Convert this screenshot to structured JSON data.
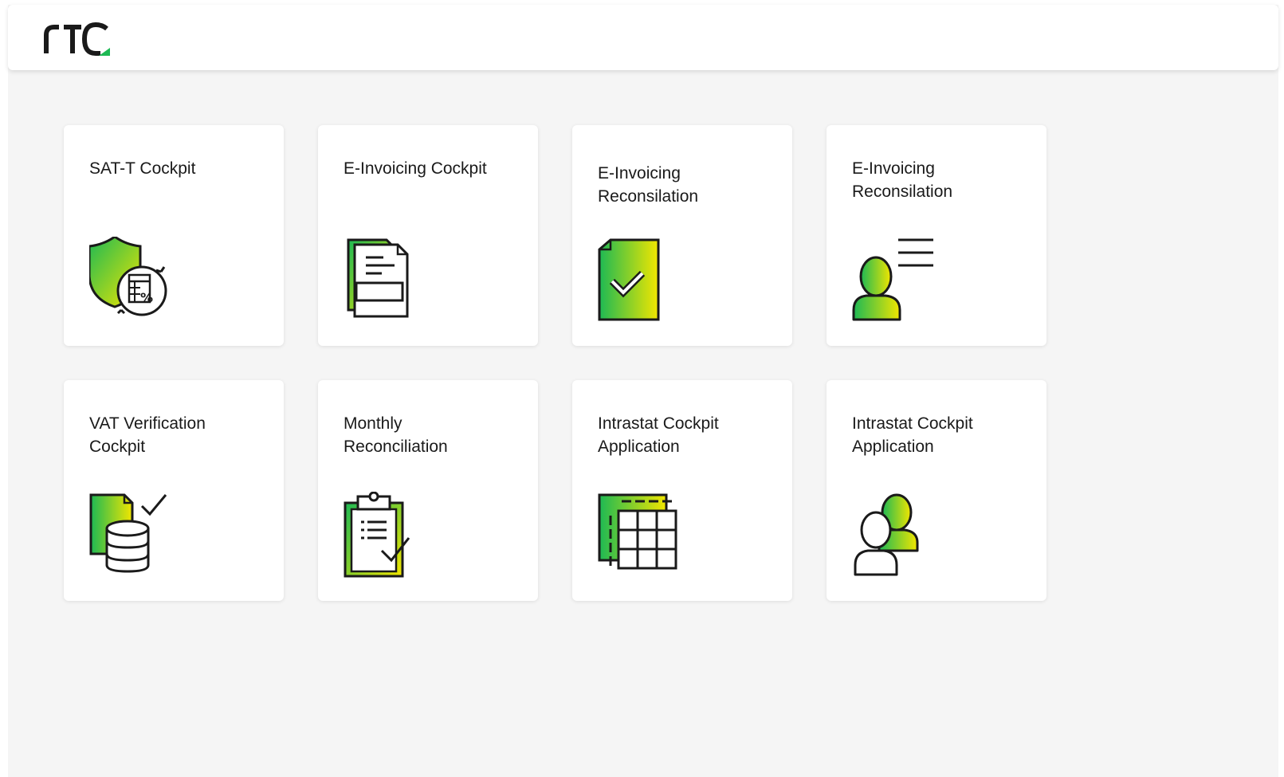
{
  "header": {
    "logo_text": "rtc"
  },
  "colors": {
    "accent_green": "#1db954",
    "accent_yellow": "#f2e600",
    "ink": "#1a1a1a",
    "background": "#f5f5f5"
  },
  "tiles": [
    {
      "title": "SAT-T Cockpit",
      "icon": "shield-calculator-icon"
    },
    {
      "title": "E-Invoicing Cockpit",
      "icon": "invoice-documents-icon"
    },
    {
      "title": "E-Invoicing\nReconsilation",
      "icon": "document-check-icon"
    },
    {
      "title": "E-Invoicing\nReconsilation",
      "icon": "user-list-icon"
    },
    {
      "title": "VAT Verification\nCockpit",
      "icon": "database-check-icon"
    },
    {
      "title": "Monthly\nReconciliation",
      "icon": "clipboard-check-icon"
    },
    {
      "title": "Intrastat Cockpit\nApplication",
      "icon": "table-grid-icon"
    },
    {
      "title": "Intrastat Cockpit\nApplication",
      "icon": "users-icon"
    }
  ]
}
